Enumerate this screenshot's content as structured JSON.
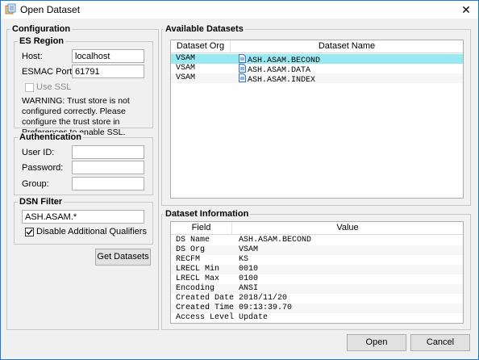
{
  "window": {
    "title": "Open Dataset",
    "close_glyph": "✕"
  },
  "config": {
    "title": "Configuration",
    "es_region": {
      "title": "ES Region",
      "host_label": "Host:",
      "host_value": "localhost",
      "port_label": "ESMAC Port:",
      "port_value": "61791",
      "ssl_label": "Use SSL",
      "warning": "WARNING: Trust store is not configured correctly. Please configure the trust store in Preferences to enable SSL."
    },
    "auth": {
      "title": "Authentication",
      "userid_label": "User ID:",
      "userid_value": "",
      "password_label": "Password:",
      "password_value": "",
      "group_label": "Group:",
      "group_value": ""
    },
    "dsn": {
      "title": "DSN Filter",
      "filter_value": "ASH.ASAM.*",
      "disable_label": "Disable Additional Qualifiers",
      "disable_checked": true
    },
    "get_button": "Get Datasets"
  },
  "datasets": {
    "title": "Available Datasets",
    "columns": [
      "Dataset Org",
      "Dataset Name"
    ],
    "rows": [
      {
        "org": "VSAM",
        "name": "ASH.ASAM.BECOND",
        "selected": true
      },
      {
        "org": "VSAM",
        "name": "ASH.ASAM.DATA",
        "selected": false
      },
      {
        "org": "VSAM",
        "name": "ASH.ASAM.INDEX",
        "selected": false
      }
    ]
  },
  "info": {
    "title": "Dataset Information",
    "columns": [
      "Field",
      "Value"
    ],
    "rows": [
      {
        "field": "DS Name",
        "value": "ASH.ASAM.BECOND"
      },
      {
        "field": "DS Org",
        "value": "VSAM"
      },
      {
        "field": "RECFM",
        "value": "KS"
      },
      {
        "field": "LRECL Min",
        "value": "0010"
      },
      {
        "field": "LRECL Max",
        "value": "0100"
      },
      {
        "field": "Encoding",
        "value": "ANSI"
      },
      {
        "field": "Created Date",
        "value": "2018/11/20"
      },
      {
        "field": "Created Time",
        "value": "09:13:39.70"
      },
      {
        "field": "Access Level",
        "value": "Update"
      }
    ]
  },
  "buttons": {
    "open": "Open",
    "cancel": "Cancel"
  },
  "colors": {
    "selection": "#99e9f3",
    "border": "#1a7ad4"
  }
}
